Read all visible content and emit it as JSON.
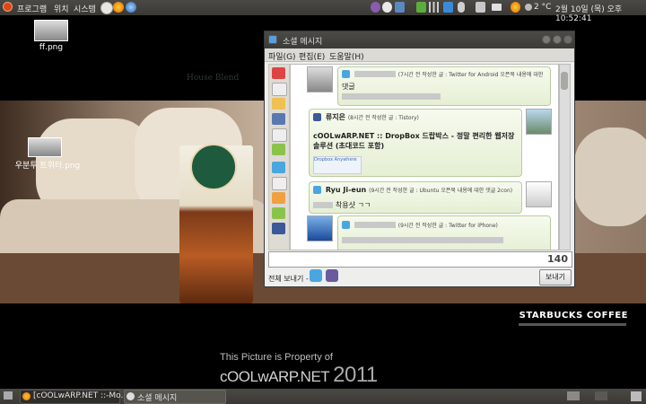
{
  "top_panel": {
    "menus": [
      "프로그램",
      "위치",
      "시스템"
    ],
    "temperature": "2 °C",
    "clock": "2월 10일 (목) 오후 10:52:41"
  },
  "desktop": {
    "icons": [
      {
        "label": "ff.png"
      },
      {
        "label": "우분투 트위터.png"
      }
    ],
    "wallpaper": {
      "bag_label": "House Blend",
      "brand": "STARBUCKS COFFEE",
      "credit_line1": "This Picture is Property of",
      "credit_line2": "cOOLwARP.NET",
      "credit_year": "2011"
    }
  },
  "window": {
    "title": "소셜 메시지",
    "menu": [
      "파일(G)",
      "편집(E)",
      "도움말(H)"
    ],
    "posts": [
      {
        "author": "",
        "meta": "(7시간 전 작성한 글 : Twitter for Android 오픈북 내용에 대한",
        "body_line2": "댓글",
        "network": "twitter"
      },
      {
        "author": "류지은",
        "meta": "(8시간 전 작성한 글 : Tistory)",
        "body": "cOOLwARP.NET :: DropBox 드랍박스 - 정말 편리한 웹저장 솔루션 (초대코드 포함)",
        "link_caption": "Dropbox Anywhere",
        "network": "facebook"
      },
      {
        "author": "Ryu Ji-eun",
        "meta": "(9시간 전 작성한 글 : Ubuntu 오픈북 내용에 대한 댓글 2con)",
        "body": "착용샷 ㄱㄱ",
        "network": "twitter"
      },
      {
        "author": "",
        "meta": "(9시간 전 작성한 글 : Twitter for iPhone)",
        "network": "twitter"
      }
    ],
    "compose_placeholder": "",
    "char_counter": "140",
    "footer_label": "전체 보내기 -",
    "send_label": "보내기"
  },
  "bottom_panel": {
    "tasks": [
      {
        "label": "[cOOLwARP.NET ::-Mo..."
      },
      {
        "label": "소셜 메시지"
      }
    ]
  },
  "colors": {
    "panel": "#3c3b37",
    "ubuntu_orange": "#dd4814",
    "twitter_blue": "#4aa6e0",
    "facebook_blue": "#3b5998",
    "post_bg": "#e8f1d8"
  }
}
